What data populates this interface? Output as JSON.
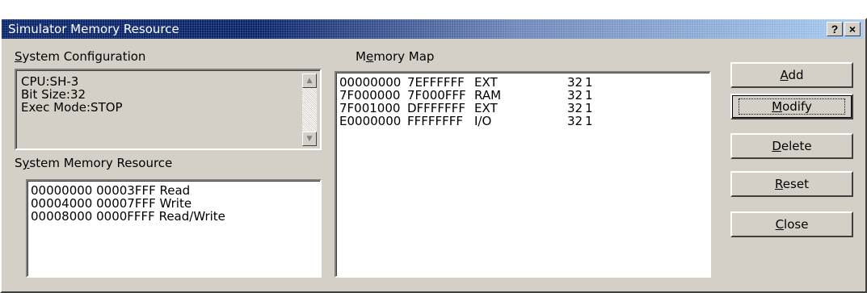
{
  "window": {
    "title": "Simulator Memory Resource",
    "help_label": "?",
    "close_label": "×"
  },
  "system_config": {
    "label": "System Configuration",
    "lines": [
      "CPU:SH-3",
      "Bit Size:32",
      "Exec Mode:STOP"
    ]
  },
  "system_memory": {
    "label": "System Memory Resource",
    "rows": [
      "00000000 00003FFF Read",
      "00004000 00007FFF Write",
      "00008000 0000FFFF Read/Write"
    ]
  },
  "memory_map": {
    "label": "Memory Map",
    "rows": [
      {
        "start": "00000000",
        "end": "7EFFFFFF",
        "type": "EXT",
        "width": "32",
        "wait": "1"
      },
      {
        "start": "7F000000",
        "end": "7F000FFF",
        "type": "RAM",
        "width": "32",
        "wait": "1"
      },
      {
        "start": "7F001000",
        "end": "DFFFFFFF",
        "type": "EXT",
        "width": "32",
        "wait": "1"
      },
      {
        "start": "E0000000",
        "end": "FFFFFFFF",
        "type": "I/O",
        "width": "32",
        "wait": "1"
      }
    ]
  },
  "buttons": {
    "add": "Add",
    "modify": "Modify",
    "delete": "Delete",
    "reset": "Reset",
    "close": "Close"
  }
}
